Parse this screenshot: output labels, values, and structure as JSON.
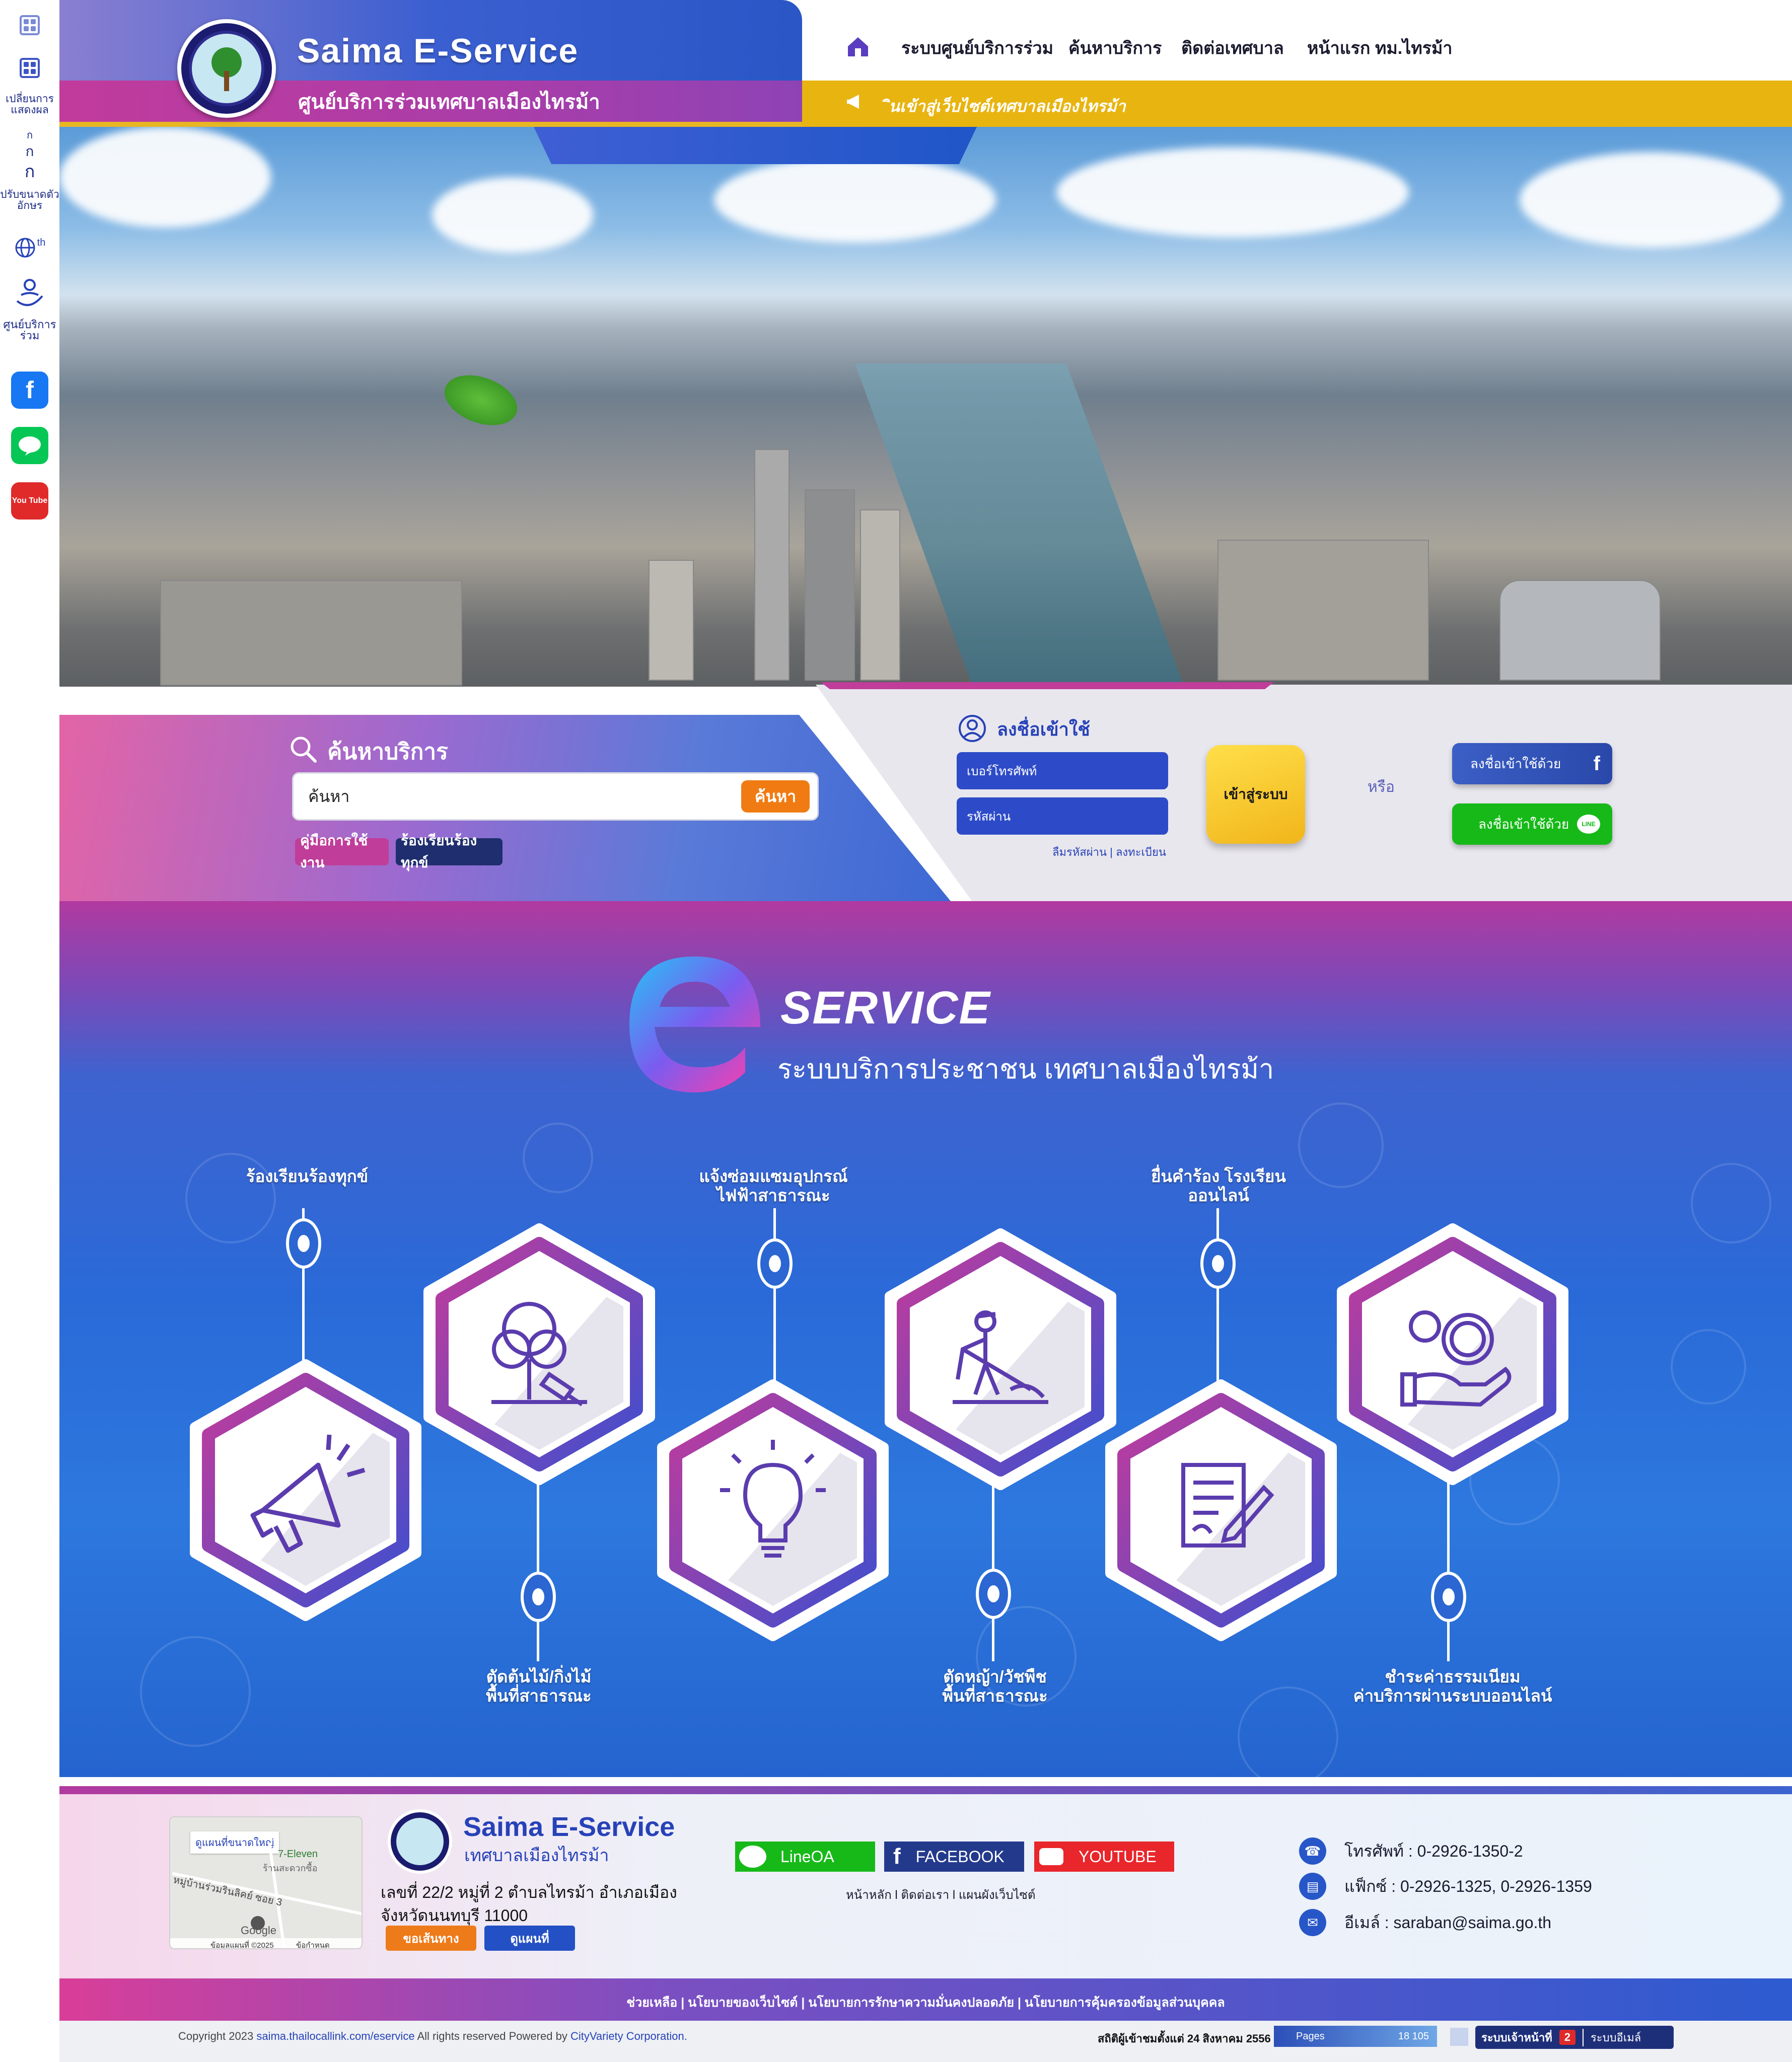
{
  "rail": {
    "display_label": "เปลี่ยนการแสดงผล",
    "font_label": "ปรับขนาดตัวอักษร",
    "font_small": "ก",
    "font_mid": "ก",
    "font_large": "ก",
    "lang": "th",
    "center_label": "ศูนย์บริการร่วม",
    "youtube_text": "You Tube"
  },
  "header": {
    "brand": "Saima E-Service",
    "subtitle": "ศูนย์บริการร่วมเทศบาลเมืองไทรม้า",
    "nav": [
      "ระบบศูนย์บริการร่วม",
      "ค้นหาบริการ",
      "ติดต่อเทศบาล",
      "หน้าแรก ทม.ไทรม้า"
    ],
    "marquee": "ินเข้าสู่เว็บไซต์เทศบาลเมืองไทรม้า"
  },
  "search": {
    "title": "ค้นหาบริการ",
    "value": "ค้นหา",
    "button": "ค้นหา",
    "tags": [
      "คู่มือการใช้งาน",
      "ร้องเรียนร้องทุกข์"
    ]
  },
  "login": {
    "title": "ลงชื่อเข้าใช้",
    "phone_placeholder": "เบอร์โทรศัพท์",
    "password_placeholder": "รหัสผ่าน",
    "forgot": "ลืมรหัสผ่าน | ลงทะเบียน",
    "enter": "เข้าสู่ระบบ",
    "or": "หรือ",
    "facebook": "ลงชื่อเข้าใช้ด้วย",
    "line": "ลงชื่อเข้าใช้ด้วย",
    "line_badge": "LINE"
  },
  "service": {
    "title": "SERVICE",
    "subtitle": "ระบบบริการประชาชน เทศบาลเมืองไทรม้า",
    "items": [
      {
        "label": "ร้องเรียนร้องทุกข์",
        "icon": "megaphone-icon"
      },
      {
        "label": "ตัดต้นไม้/กิ่งไม้\nพื้นที่สาธารณะ",
        "icon": "tree-cutting-icon"
      },
      {
        "label": "แจ้งซ่อมแซมอุปกรณ์\nไฟฟ้าสาธารณะ",
        "icon": "lightbulb-icon"
      },
      {
        "label": "ตัดหญ้า/วัชพืช\nพื้นที่สาธารณะ",
        "icon": "grass-cutting-icon"
      },
      {
        "label": "ยื่นคำร้อง โรงเรียน\nออนไลน์",
        "icon": "document-sign-icon"
      },
      {
        "label": "ชำระค่าธรรมเนียม\nค่าบริการผ่านระบบออนไลน์",
        "icon": "payment-hand-icon"
      }
    ]
  },
  "footer": {
    "map_label": "ดูแผนที่ขนาดใหญ่",
    "map_place1": "7-Eleven",
    "map_place2": "ร้านสะดวกซื้อ",
    "map_road": "หมู่บ้านร่วมรินลิคย์ ซอย 3",
    "map_google": "Google",
    "map_copyright": "ข้อมูลแผนที่ ©2025",
    "map_terms": "ข้อกำหนด",
    "brand": "Saima E-Service",
    "brand_sub": "เทศบาลเมืองไทรม้า",
    "address1": "เลขที่ 22/2 หมู่ที่ 2 ตำบลไทรม้า อำเภอเมือง",
    "address2": "จังหวัดนนทบุรี 11000",
    "route_btn": "ขอเส้นทาง",
    "map_btn": "ดูแผนที่",
    "social": [
      "LineOA",
      "FACEBOOK",
      "YOUTUBE"
    ],
    "links": "หน้าหลัก  l  ติดต่อเรา  l  แผนผังเว็บไซต์",
    "phone": "โทรศัพท์ : 0-2926-1350-2",
    "fax": "แฟ็กซ์ : 0-2926-1325, 0-2926-1359",
    "email": "อีเมล์ : saraban@saima.go.th",
    "policy": "ช่วยเหลือ | นโยบายของเว็บไซต์ | นโยบายการรักษาความมั่นคงปลอดภัย | นโยบายการคุ้มครองข้อมูลส่วนบุคคล",
    "copyright_pre": "Copyright 2023 ",
    "copyright_link": "saima.thailocallink.com/eservice",
    "copyright_mid": " All rights reserved Powered by ",
    "copyright_company": "CityVariety Corporation.",
    "stats_label": "สถิติผู้เข้าชมตั้งแต่ 24 สิงหาคม 2556",
    "stats_pages": "Pages",
    "stats_count": "18 105",
    "staff_system": "ระบบเจ้าหน้าที่",
    "staff_badge": "2",
    "email_system": "ระบบอีเมล์"
  },
  "colors": {
    "brand_blue": "#2742b8",
    "brand_pink": "#c13b9c",
    "marquee_yellow": "#e8b410",
    "search_orange": "#f07b12",
    "line_green": "#17b919"
  }
}
